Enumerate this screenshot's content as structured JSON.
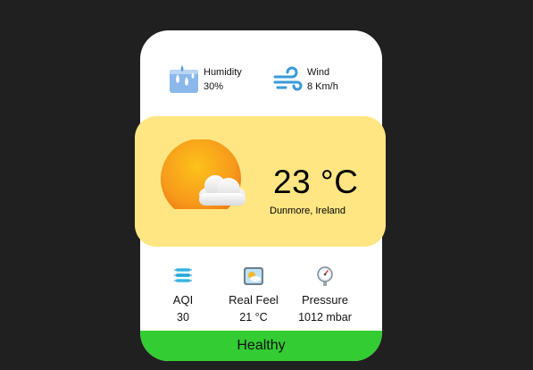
{
  "top_stats": {
    "humidity": {
      "label": "Humidity",
      "value": "30%",
      "icon": "humidity-icon"
    },
    "wind": {
      "label": "Wind",
      "value": "8 Km/h",
      "icon": "wind-icon"
    }
  },
  "current": {
    "temperature": "23 °C",
    "location": "Dunmore, Ireland",
    "icon": "partly-cloudy-sun-icon"
  },
  "metrics": [
    {
      "label": "AQI",
      "value": "30",
      "icon": "air-quality-icon"
    },
    {
      "label": "Real Feel",
      "value": "21 °C",
      "icon": "real-feel-icon"
    },
    {
      "label": "Pressure",
      "value": "1012 mbar",
      "icon": "pressure-gauge-icon"
    }
  ],
  "status": {
    "label": "Healthy"
  },
  "colors": {
    "background": "#202020",
    "card": "#ffffff",
    "hero": "#ffe683",
    "status": "#33cc33",
    "sun": "#f7a21b",
    "accent_blue": "#3a9ad9"
  }
}
